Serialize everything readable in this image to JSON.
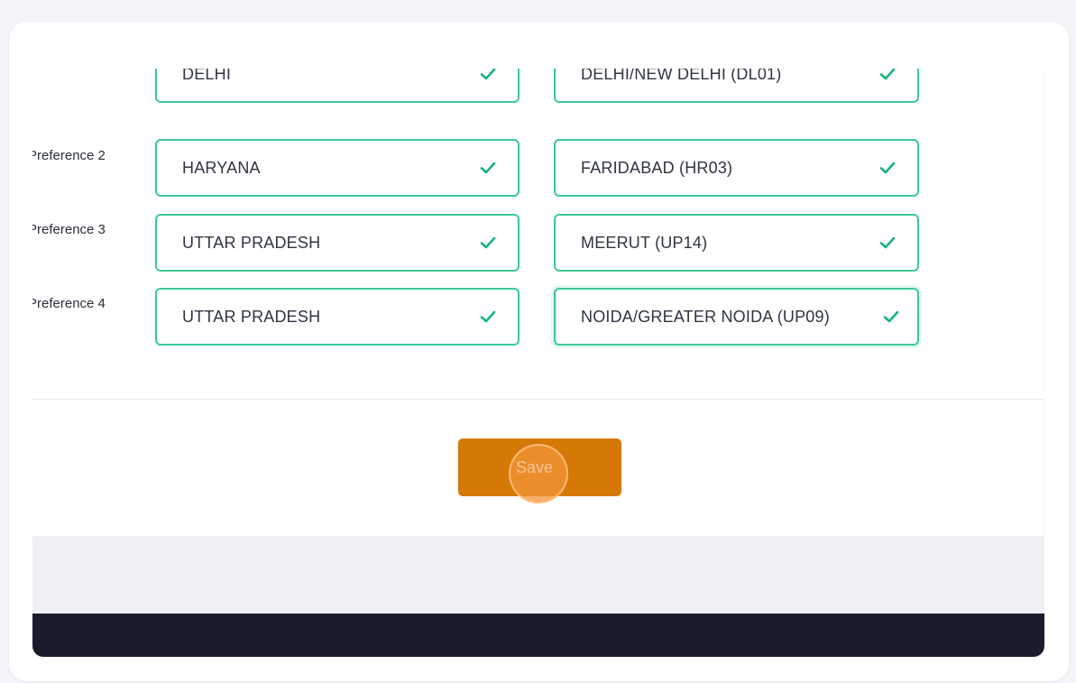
{
  "preferences": [
    {
      "label": "",
      "state": "DELHI",
      "district": "DELHI/NEW DELHI (DL01)"
    },
    {
      "label": "Preference 2",
      "state": "HARYANA",
      "district": "FARIDABAD (HR03)"
    },
    {
      "label": "Preference 3",
      "state": "UTTAR PRADESH",
      "district": "MEERUT (UP14)"
    },
    {
      "label": "Preference 4",
      "state": "UTTAR PRADESH",
      "district": "NOIDA/GREATER NOIDA (UP09)"
    }
  ],
  "actions": {
    "save_label": "Save"
  },
  "colors": {
    "field_border": "#3cc89a",
    "check": "#19b37e",
    "save_button": "#d47806",
    "footer": "#1a1c2e"
  },
  "icons": {
    "field_status": "check-icon"
  }
}
